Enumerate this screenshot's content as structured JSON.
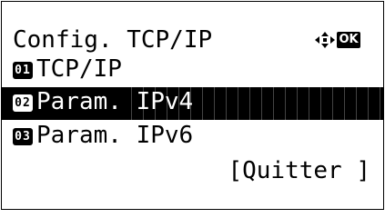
{
  "screen": {
    "title": "Config. TCP/IP",
    "nav_icon": "four-way-arrow-icon",
    "ok_label": "OK",
    "items": [
      {
        "number": "01",
        "label": "TCP/IP",
        "selected": false
      },
      {
        "number": "02",
        "label": "Param. IPv4",
        "selected": true
      },
      {
        "number": "03",
        "label": "Param. IPv6",
        "selected": false
      }
    ],
    "quit_label": "[Quitter ]"
  }
}
